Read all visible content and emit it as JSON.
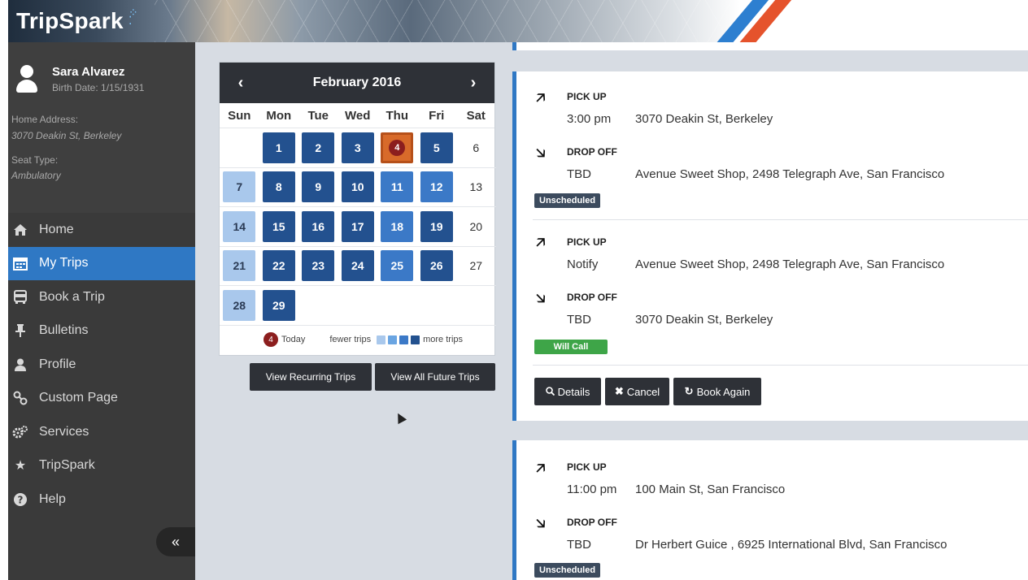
{
  "app": {
    "logo": "TripSpark"
  },
  "profile": {
    "name": "Sara Alvarez",
    "birth_date": "Birth Date: 1/15/1931",
    "home_address_label": "Home Address:",
    "home_address": "3070 Deakin St, Berkeley",
    "seat_type_label": "Seat Type:",
    "seat_type": "Ambulatory"
  },
  "nav": [
    {
      "label": "Home",
      "icon": "home-icon",
      "active": false
    },
    {
      "label": "My Trips",
      "icon": "calendar-icon",
      "active": true
    },
    {
      "label": "Book a Trip",
      "icon": "bus-icon",
      "active": false
    },
    {
      "label": "Bulletins",
      "icon": "pin-icon",
      "active": false
    },
    {
      "label": "Profile",
      "icon": "user-icon",
      "active": false
    },
    {
      "label": "Custom Page",
      "icon": "link-icon",
      "active": false
    },
    {
      "label": "Services",
      "icon": "gears-icon",
      "active": false
    },
    {
      "label": "TripSpark",
      "icon": "star-icon",
      "active": false
    },
    {
      "label": "Help",
      "icon": "help-icon",
      "active": false
    }
  ],
  "sidebar": {
    "collapse_label": "«"
  },
  "calendar": {
    "title": "February 2016",
    "prev": "‹",
    "next": "›",
    "days_of_week": [
      "Sun",
      "Mon",
      "Tue",
      "Wed",
      "Thu",
      "Fri",
      "Sat"
    ],
    "weeks": [
      [
        {
          "d": ""
        },
        {
          "d": "1",
          "lvl": 4
        },
        {
          "d": "2",
          "lvl": 4
        },
        {
          "d": "3",
          "lvl": 4
        },
        {
          "d": "4",
          "lvl": "today"
        },
        {
          "d": "5",
          "lvl": 4
        },
        {
          "d": "6"
        }
      ],
      [
        {
          "d": "7",
          "lvl": 1
        },
        {
          "d": "8",
          "lvl": 4
        },
        {
          "d": "9",
          "lvl": 4
        },
        {
          "d": "10",
          "lvl": 4
        },
        {
          "d": "11",
          "lvl": 3
        },
        {
          "d": "12",
          "lvl": 3
        },
        {
          "d": "13"
        }
      ],
      [
        {
          "d": "14",
          "lvl": 1
        },
        {
          "d": "15",
          "lvl": 4
        },
        {
          "d": "16",
          "lvl": 4
        },
        {
          "d": "17",
          "lvl": 4
        },
        {
          "d": "18",
          "lvl": 3
        },
        {
          "d": "19",
          "lvl": 4
        },
        {
          "d": "20"
        }
      ],
      [
        {
          "d": "21",
          "lvl": 1
        },
        {
          "d": "22",
          "lvl": 4
        },
        {
          "d": "23",
          "lvl": 4
        },
        {
          "d": "24",
          "lvl": 4
        },
        {
          "d": "25",
          "lvl": 3
        },
        {
          "d": "26",
          "lvl": 4
        },
        {
          "d": "27"
        }
      ],
      [
        {
          "d": "28",
          "lvl": 1
        },
        {
          "d": "29",
          "lvl": 4
        },
        {
          "d": ""
        },
        {
          "d": ""
        },
        {
          "d": ""
        },
        {
          "d": ""
        },
        {
          "d": ""
        }
      ]
    ],
    "legend": {
      "today_label": "Today",
      "today_num": "4",
      "fewer": "fewer trips",
      "more": "more trips"
    },
    "buttons": {
      "recurring": "View Recurring Trips",
      "future": "View All Future Trips"
    }
  },
  "trips": {
    "pickup_label": "PICK UP",
    "dropoff_label": "DROP OFF",
    "items": [
      {
        "pickup_time": "3:00 pm",
        "pickup_addr": "3070 Deakin St, Berkeley",
        "dropoff_time": "TBD",
        "dropoff_addr": "Avenue Sweet Shop, 2498 Telegraph Ave, San Francisco",
        "status": "Unscheduled"
      },
      {
        "pickup_time": "Notify",
        "pickup_addr": "Avenue Sweet Shop, 2498 Telegraph Ave, San Francisco",
        "dropoff_time": "TBD",
        "dropoff_addr": "3070 Deakin St, Berkeley",
        "status": "Will Call"
      },
      {
        "pickup_time": "11:00 pm",
        "pickup_addr": "100 Main St, San Francisco",
        "dropoff_time": "TBD",
        "dropoff_addr": "Dr Herbert Guice , 6925 International Blvd, San Francisco",
        "status": "Unscheduled"
      }
    ],
    "actions": {
      "details": "Details",
      "cancel": "Cancel",
      "book_again": "Book Again"
    }
  },
  "colors": {
    "accent": "#2f78c4",
    "sidebar_bg": "#3a3a3a",
    "today": "#d86a2a",
    "unscheduled": "#3c4b5e",
    "will_call": "#3ea548"
  }
}
